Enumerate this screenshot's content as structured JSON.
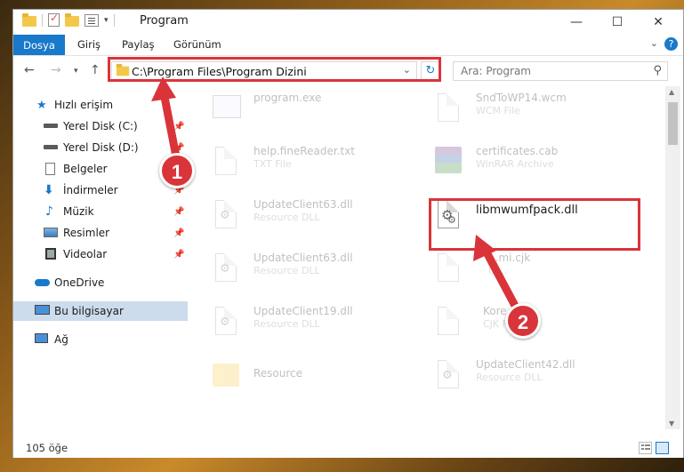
{
  "window": {
    "title": "Program",
    "controls": {
      "minimize": "—",
      "maximize": "☐",
      "close": "✕"
    }
  },
  "ribbon": {
    "tabs": [
      "Dosya",
      "Giriş",
      "Paylaş",
      "Görünüm"
    ]
  },
  "navigation": {
    "address": "C:\\Program Files\\Program Dizini",
    "search_placeholder": "Ara: Program"
  },
  "sidebar": {
    "items": [
      {
        "label": "Hızlı erişim",
        "icon": "star-icon"
      },
      {
        "label": "Yerel Disk (C:)",
        "icon": "drive-icon"
      },
      {
        "label": "Yerel Disk (D:)",
        "icon": "drive-icon"
      },
      {
        "label": "Belgeler",
        "icon": "documents-icon"
      },
      {
        "label": "İndirmeler",
        "icon": "download-icon"
      },
      {
        "label": "Müzik",
        "icon": "music-icon"
      },
      {
        "label": "Resimler",
        "icon": "pictures-icon"
      },
      {
        "label": "Videolar",
        "icon": "videos-icon"
      },
      {
        "label": "OneDrive",
        "icon": "cloud-icon"
      },
      {
        "label": "Bu bilgisayar",
        "icon": "computer-icon"
      },
      {
        "label": "Ağ",
        "icon": "network-icon"
      }
    ]
  },
  "files": [
    {
      "name": "program.exe",
      "type": ""
    },
    {
      "name": "SndToWP14.wcm",
      "type": "WCM File"
    },
    {
      "name": "help.fineReader.txt",
      "type": "TXT File"
    },
    {
      "name": "certificates.cab",
      "type": "WinRAR Archive"
    },
    {
      "name": "UpdateClient63.dll",
      "type": "Resource DLL"
    },
    {
      "name": "libmwumfpack.dll",
      "type": ""
    },
    {
      "name": "UpdateClient63.dll",
      "type": "Resource DLL"
    },
    {
      "name": "...mi.cjk",
      "type": "CJ..."
    },
    {
      "name": "UpdateClient19.dll",
      "type": "Resource DLL"
    },
    {
      "name": "Kore...",
      "type": "CJK Fi..."
    },
    {
      "name": "Resource",
      "type": ""
    },
    {
      "name": "UpdateClient42.dll",
      "type": "Resource DLL"
    }
  ],
  "status": {
    "count": "105 öğe"
  },
  "annotations": {
    "step1": "1",
    "step2": "2"
  },
  "colors": {
    "accent": "#1979ca",
    "highlight": "#d9343a",
    "selected": "#ccdcec"
  }
}
